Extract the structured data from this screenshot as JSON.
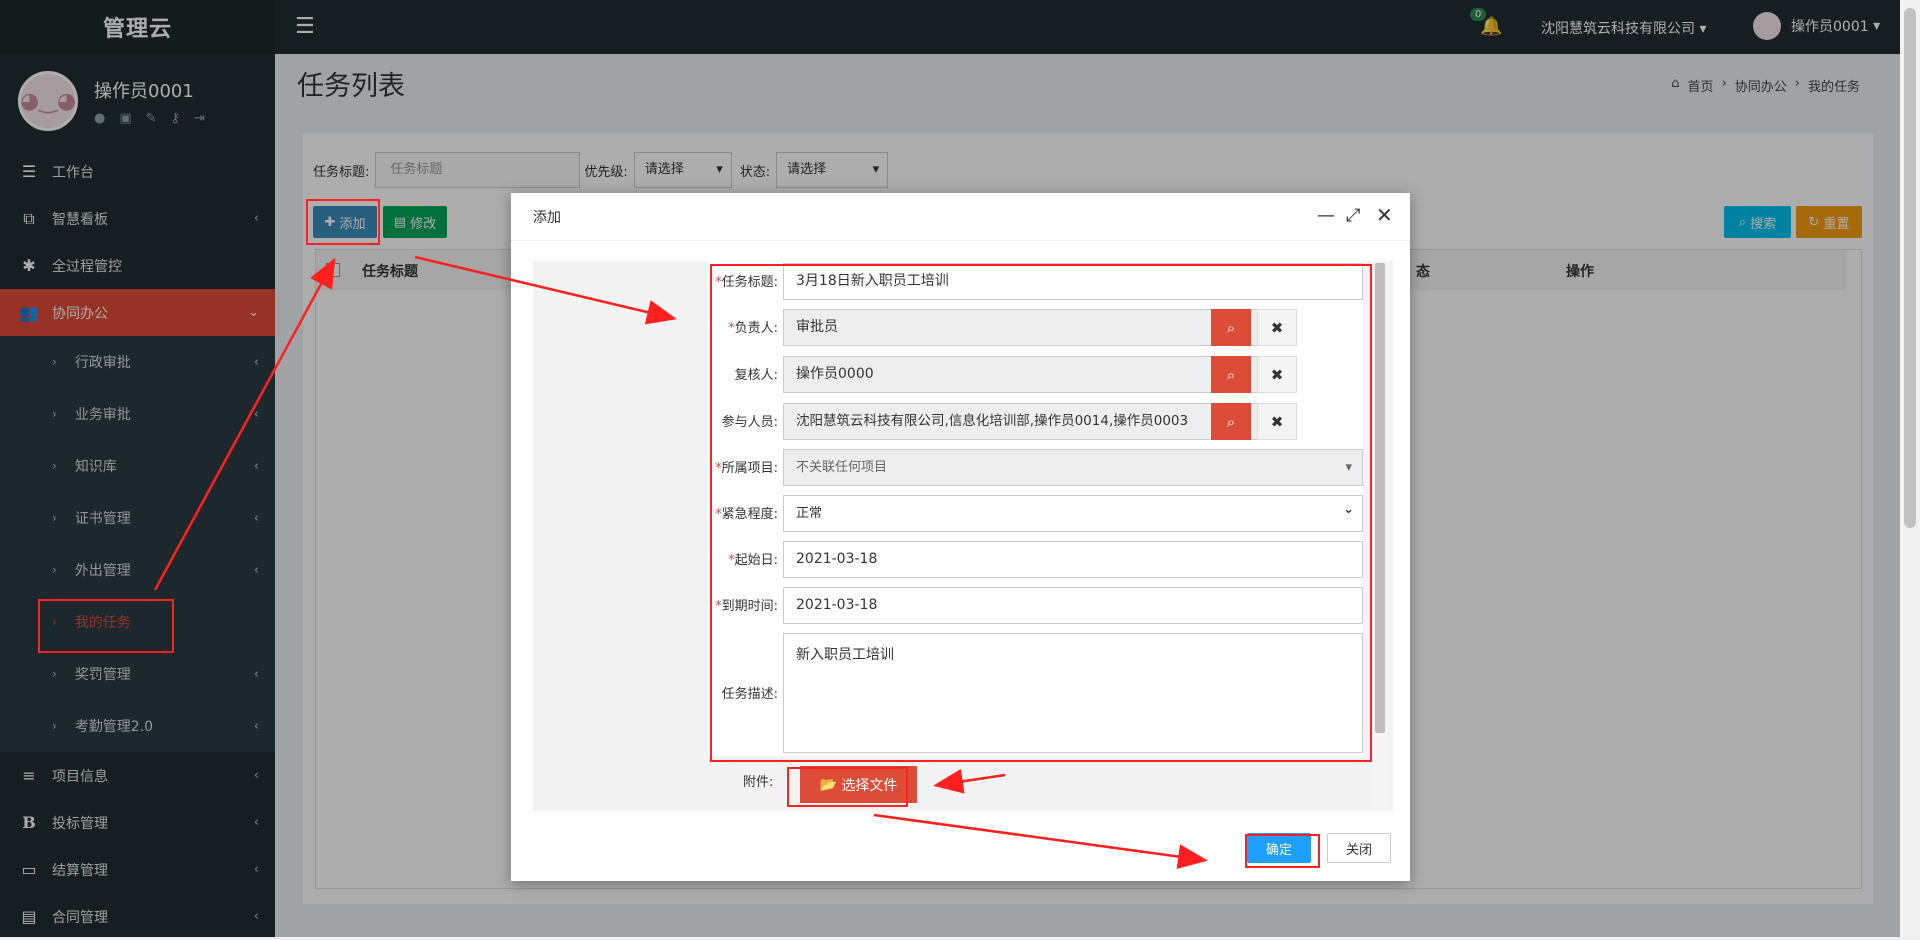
{
  "app": {
    "title": "管理云"
  },
  "user": {
    "name": "操作员0001"
  },
  "sidebar": {
    "items": [
      {
        "label": "工作台",
        "icon": "dashboard-icon"
      },
      {
        "label": "智慧看板",
        "icon": "board-icon"
      },
      {
        "label": "全过程管控",
        "icon": "asterisk-icon"
      },
      {
        "label": "协同办公",
        "icon": "group-icon",
        "active": true
      }
    ],
    "subitems": [
      {
        "label": "行政审批"
      },
      {
        "label": "业务审批"
      },
      {
        "label": "知识库"
      },
      {
        "label": "证书管理"
      },
      {
        "label": "外出管理"
      },
      {
        "label": "我的任务",
        "current": true
      },
      {
        "label": "奖罚管理"
      },
      {
        "label": "考勤管理2.0"
      }
    ],
    "bottom_items": [
      {
        "label": "项目信息",
        "icon": "list-icon"
      },
      {
        "label": "投标管理",
        "icon": "bold-b-icon"
      },
      {
        "label": "结算管理",
        "icon": "monitor-icon"
      },
      {
        "label": "合同管理",
        "icon": "file-icon"
      }
    ]
  },
  "header": {
    "notification_count": "0",
    "company": "沈阳慧筑云科技有限公司",
    "user": "操作员0001"
  },
  "page": {
    "title": "任务列表",
    "breadcrumb": [
      "首页",
      "协同办公",
      "我的任务"
    ]
  },
  "filters": {
    "title_label": "任务标题:",
    "title_placeholder": "任务标题",
    "priority_label": "优先级:",
    "priority_value": "请选择",
    "status_label": "状态:",
    "status_value": "请选择"
  },
  "toolbar": {
    "add": "添加",
    "edit": "修改",
    "search": "搜索",
    "reset": "重置"
  },
  "table": {
    "headers": [
      "任务标题",
      "态",
      "操作"
    ]
  },
  "modal": {
    "title": "添加",
    "fields": {
      "task_title": {
        "label": "任务标题:",
        "value": "3月18日新入职员工培训"
      },
      "owner": {
        "label": "负责人:",
        "value": "审批员"
      },
      "reviewer": {
        "label": "复核人:",
        "value": "操作员0000"
      },
      "participants": {
        "label": "参与人员:",
        "value": "沈阳慧筑云科技有限公司,信息化培训部,操作员0014,操作员0003"
      },
      "project": {
        "label": "所属项目:",
        "value": "不关联任何项目"
      },
      "urgency": {
        "label": "紧急程度:",
        "value": "正常"
      },
      "start_date": {
        "label": "起始日:",
        "value": "2021-03-18"
      },
      "due_date": {
        "label": "到期时间:",
        "value": "2021-03-18"
      },
      "description": {
        "label": "任务描述:",
        "value": "新入职员工培训"
      }
    },
    "attachment_label": "附件:",
    "choose_file": "选择文件",
    "confirm": "确定",
    "close": "关闭"
  }
}
